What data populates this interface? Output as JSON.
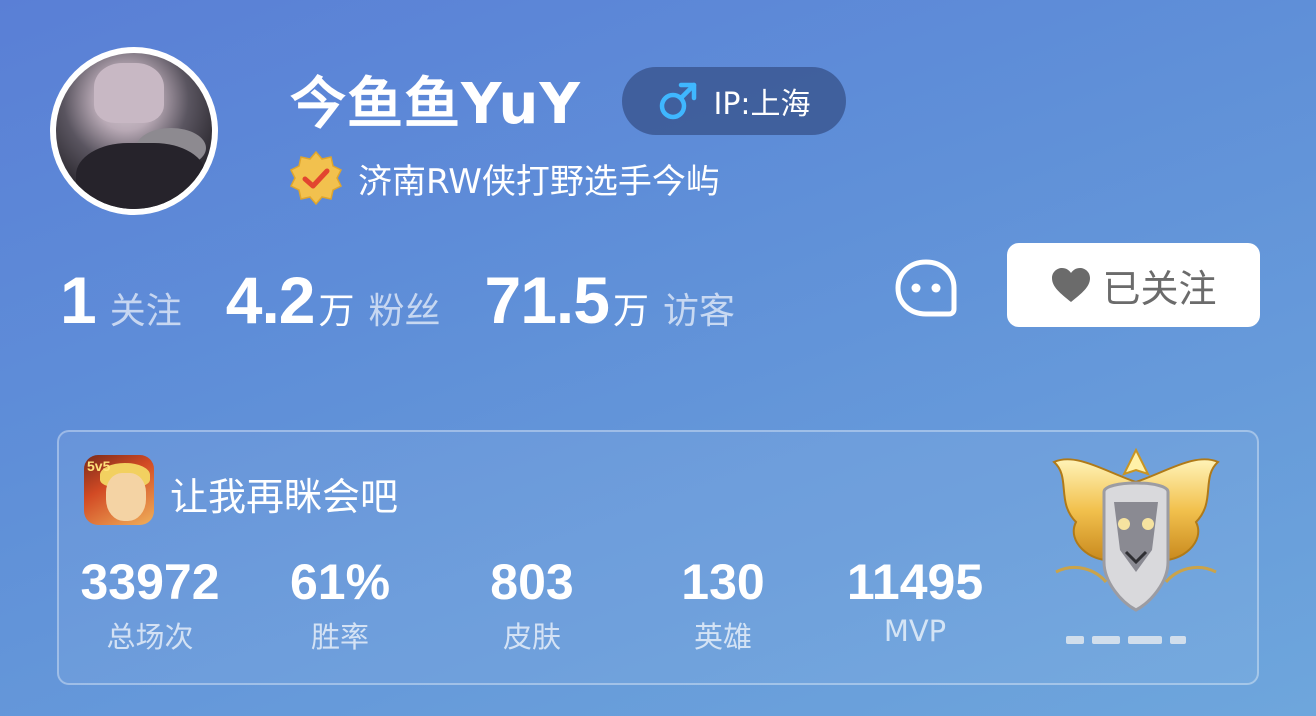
{
  "profile": {
    "username": "今鱼鱼YuY",
    "ip_location": "IP:上海",
    "verification_text": "济南RW侠打野选手今屿"
  },
  "stats": {
    "following": {
      "value": "1",
      "unit": "",
      "label": "关注"
    },
    "fans": {
      "value": "4.2",
      "unit": "万",
      "label": "粉丝"
    },
    "visitors": {
      "value": "71.5",
      "unit": "万",
      "label": "访客"
    }
  },
  "actions": {
    "follow_label": "已关注"
  },
  "game_card": {
    "game_icon_tag": "5v5",
    "game_name": "让我再眯会吧",
    "stats": [
      {
        "value": "33972",
        "label": "总场次"
      },
      {
        "value": "61%",
        "label": "胜率"
      },
      {
        "value": "803",
        "label": "皮肤"
      },
      {
        "value": "130",
        "label": "英雄"
      },
      {
        "value": "11495",
        "label": "MVP"
      }
    ]
  },
  "icons": {
    "gender": "male-icon",
    "verify": "verified-badge-icon",
    "chat": "chat-icon",
    "follow": "heart-icon",
    "rank": "rank-emblem-icon"
  },
  "colors": {
    "background_start": "#5a7fd6",
    "background_end": "#6ea6dc",
    "gender_icon": "#3fb7ff",
    "verify_badge": "#f2c14e"
  }
}
